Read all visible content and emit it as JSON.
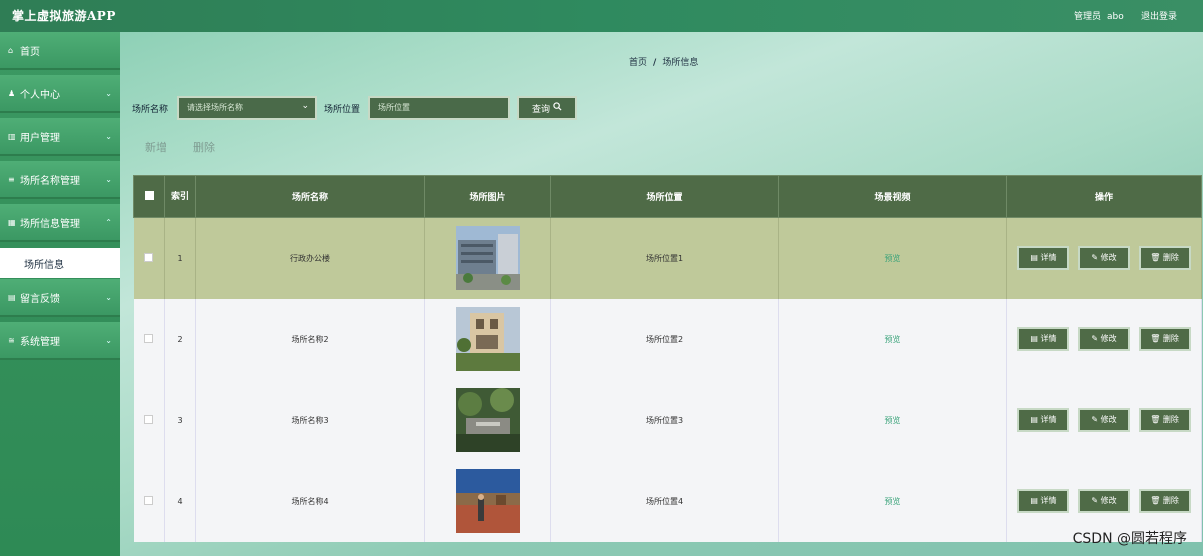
{
  "app": {
    "title": "掌上虚拟旅游APP",
    "admin_label": "管理员",
    "admin_name": "abo",
    "logout": "退出登录"
  },
  "sidebar": {
    "items": [
      {
        "icon": "⌂",
        "label": "首页"
      },
      {
        "icon": "♟",
        "label": "个人中心"
      },
      {
        "icon": "▥",
        "label": "用户管理"
      },
      {
        "icon": "≡",
        "label": "场所名称管理"
      },
      {
        "icon": "▦",
        "label": "场所信息管理"
      },
      {
        "icon": "▤",
        "label": "留言反馈"
      },
      {
        "icon": "≊",
        "label": "系统管理"
      }
    ],
    "sub_active": "场所信息"
  },
  "breadcrumb": {
    "home": "首页",
    "sep": "/",
    "current": "场所信息"
  },
  "search": {
    "name_label": "场所名称",
    "name_placeholder": "请选择场所名称",
    "loc_label": "场所位置",
    "loc_placeholder": "场所位置",
    "query": "查询"
  },
  "toolbar": {
    "add": "新增",
    "delete": "删除"
  },
  "table": {
    "headers": [
      "",
      "索引",
      "场所名称",
      "场所图片",
      "场所位置",
      "场景视频",
      "操作"
    ],
    "rows": [
      {
        "index": "1",
        "name": "行政办公楼",
        "location": "场所位置1",
        "video": "预览"
      },
      {
        "index": "2",
        "name": "场所名称2",
        "location": "场所位置2",
        "video": "预览"
      },
      {
        "index": "3",
        "name": "场所名称3",
        "location": "场所位置3",
        "video": "预览"
      },
      {
        "index": "4",
        "name": "场所名称4",
        "location": "场所位置4",
        "video": "预览"
      }
    ],
    "actions": {
      "detail": "详情",
      "edit": "修改",
      "remove": "删除"
    }
  },
  "watermark": "CSDN @圆若程序",
  "colors": {
    "header_green": "#2f8a5f",
    "table_header": "#4f6b47",
    "highlight_row": "#bfc99a"
  }
}
